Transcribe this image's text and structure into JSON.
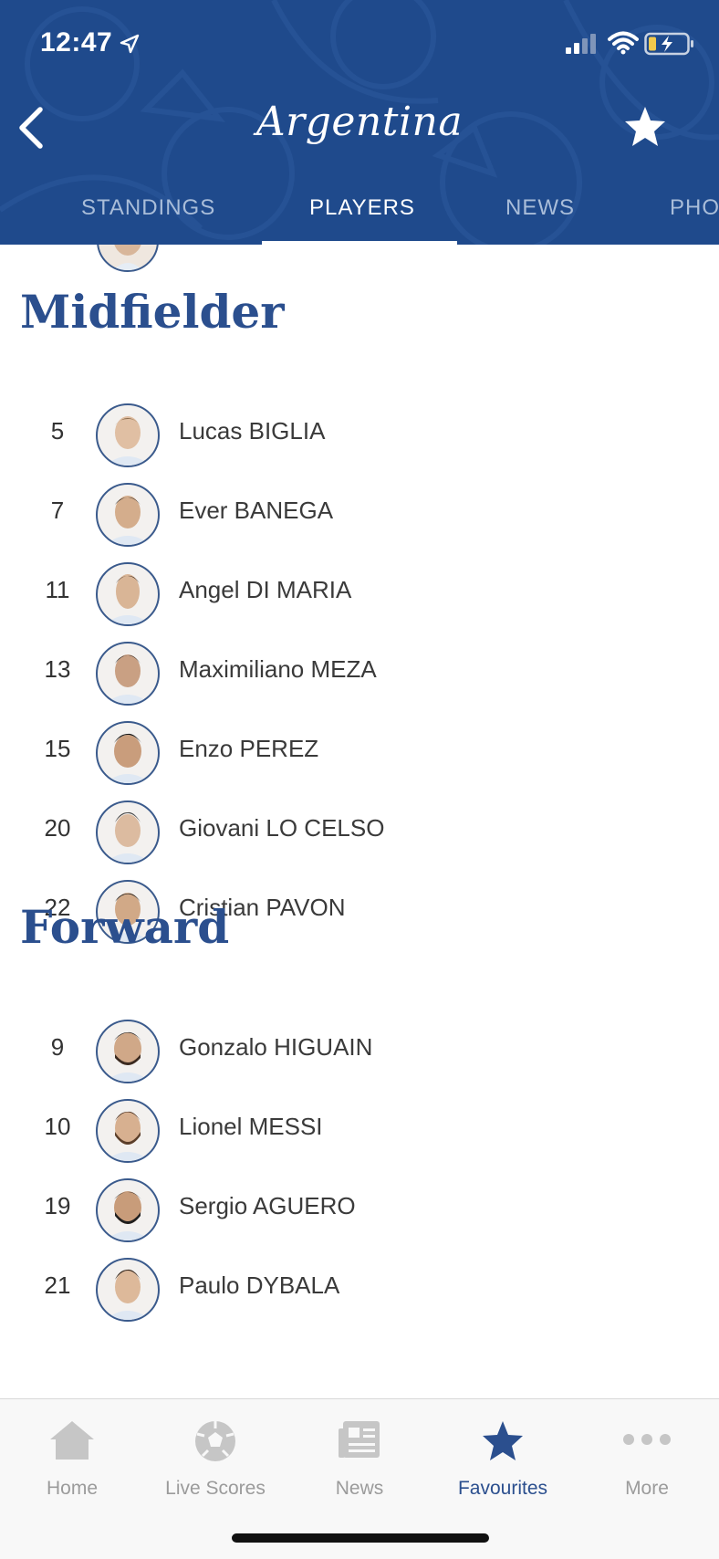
{
  "status_bar": {
    "time": "12:47"
  },
  "header": {
    "title": "Argentina",
    "tabs": [
      {
        "label": "STANDINGS",
        "active": false
      },
      {
        "label": "PLAYERS",
        "active": true
      },
      {
        "label": "NEWS",
        "active": false
      },
      {
        "label": "PHO",
        "active": false
      }
    ]
  },
  "sections": [
    {
      "title": "Midfielder",
      "players": [
        {
          "number": "5",
          "name": "Lucas BIGLIA"
        },
        {
          "number": "7",
          "name": "Ever BANEGA"
        },
        {
          "number": "11",
          "name": "Angel DI MARIA"
        },
        {
          "number": "13",
          "name": "Maximiliano MEZA"
        },
        {
          "number": "15",
          "name": "Enzo PEREZ"
        },
        {
          "number": "20",
          "name": "Giovani LO CELSO"
        },
        {
          "number": "22",
          "name": "Cristian PAVON"
        }
      ]
    },
    {
      "title": "Forward",
      "players": [
        {
          "number": "9",
          "name": "Gonzalo HIGUAIN"
        },
        {
          "number": "10",
          "name": "Lionel MESSI"
        },
        {
          "number": "19",
          "name": "Sergio AGUERO"
        },
        {
          "number": "21",
          "name": "Paulo DYBALA"
        }
      ]
    }
  ],
  "tab_bar": {
    "items": [
      {
        "label": "Home",
        "icon": "home-icon",
        "active": false
      },
      {
        "label": "Live Scores",
        "icon": "football-icon",
        "active": false
      },
      {
        "label": "News",
        "icon": "newspaper-icon",
        "active": false
      },
      {
        "label": "Favourites",
        "icon": "star-icon",
        "active": true
      },
      {
        "label": "More",
        "icon": "more-dots-icon",
        "active": false
      }
    ]
  },
  "colors": {
    "header_bg": "#1f4a8c",
    "accent": "#2b4f8e",
    "inactive_tab": "#a9bdd9",
    "tabbar_inactive": "#9b9b9b"
  }
}
